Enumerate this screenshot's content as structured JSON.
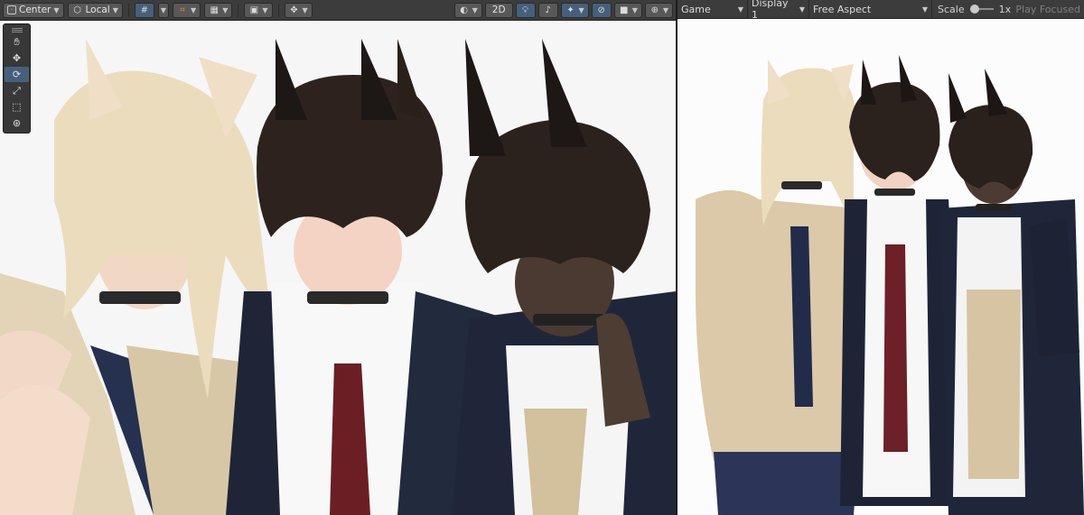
{
  "scene_toolbar": {
    "pivot_label": "Center",
    "space_label": "Local",
    "mode_2d_label": "2D"
  },
  "game_toolbar": {
    "view_label": "Game",
    "display_label": "Display 1",
    "aspect_label": "Free Aspect",
    "scale_label": "Scale",
    "scale_value": "1x",
    "play_focused_label": "Play Focused"
  },
  "tools": [
    "hand-tool",
    "move-tool",
    "rotate-tool",
    "scale-tool",
    "rect-tool",
    "transform-tool"
  ],
  "selected_tool": "rotate-tool",
  "colors": {
    "toolbar_bg": "#3c3c3c",
    "button_bg": "#585858",
    "active_blue": "#46607c",
    "scene_bg": "#f6f6f6",
    "game_bg": "#fcfcfc"
  }
}
